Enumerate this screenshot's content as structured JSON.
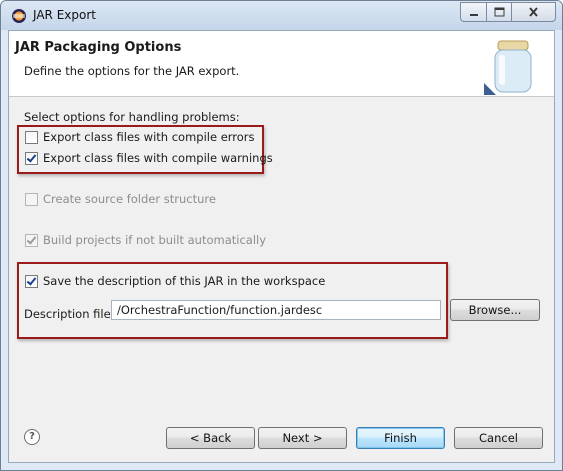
{
  "window": {
    "title": "JAR Export",
    "app_icon": "eclipse-icon",
    "controls": {
      "minimize": "minimize-icon",
      "maximize": "maximize-icon",
      "close": "close-icon"
    }
  },
  "banner": {
    "title": "JAR Packaging Options",
    "description": "Define the options for the JAR export.",
    "icon": "jar-icon"
  },
  "problems": {
    "label": "Select options for handling problems:",
    "options": [
      {
        "label": "Export class files with compile errors",
        "checked": false,
        "enabled": true
      },
      {
        "label": "Export class files with compile warnings",
        "checked": true,
        "enabled": true
      }
    ]
  },
  "source_folder": {
    "label": "Create source folder structure",
    "checked": false,
    "enabled": false
  },
  "build": {
    "label": "Build projects if not built automatically",
    "checked": true,
    "enabled": false
  },
  "save_description": {
    "label": "Save the description of this JAR in the workspace",
    "checked": true
  },
  "description_file": {
    "label": "Description file:",
    "value": "/OrchestraFunction/function.jardesc",
    "browse_label": "Browse..."
  },
  "footer": {
    "help_icon": "help-icon",
    "help_glyph": "?",
    "back_label": "< Back",
    "next_label": "Next >",
    "finish_label": "Finish",
    "cancel_label": "Cancel"
  },
  "colors": {
    "highlight_border": "#9b1b1b",
    "default_button": "#3c7fb1"
  }
}
